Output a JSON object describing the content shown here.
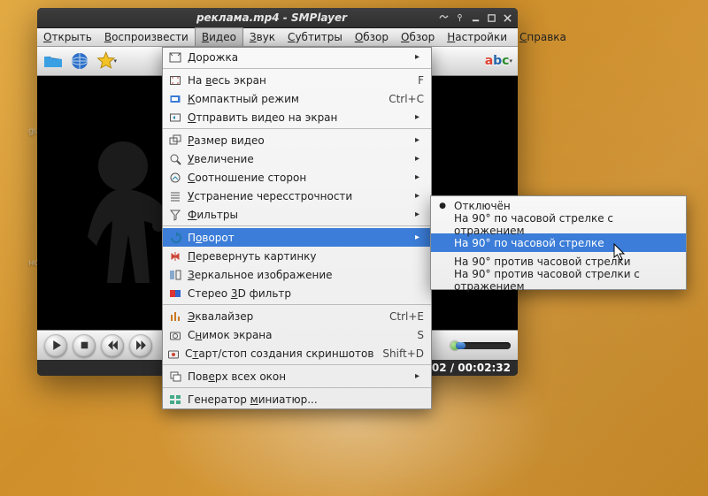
{
  "window": {
    "title": "реклама.mp4 - SMPlayer",
    "controls_icons": [
      "integrate-icon",
      "pin-icon",
      "minimize-icon",
      "maximize-icon",
      "close-icon"
    ]
  },
  "menubar": [
    {
      "label": "Открыть",
      "u": 0
    },
    {
      "label": "Воспроизвести",
      "u": 0
    },
    {
      "label": "Видео",
      "u": 0,
      "active": true
    },
    {
      "label": "Звук",
      "u": 0
    },
    {
      "label": "Субтитры",
      "u": 0
    },
    {
      "label": "Обзор",
      "u": 0
    },
    {
      "label": "Обзор",
      "u": 0
    },
    {
      "label": "Настройки",
      "u": 0
    },
    {
      "label": "Справка",
      "u": 0
    }
  ],
  "toolbar_icons": [
    "open-folder-icon",
    "globe-icon",
    "favorites-star-icon",
    "subtitles-abc-icon"
  ],
  "playback": {
    "buttons": [
      "play-icon",
      "stop-icon",
      "prev-icon",
      "next-icon"
    ],
    "position_pct": 1.4,
    "volume_pct": 18
  },
  "status": {
    "time": "00:00:02 / 00:02:32"
  },
  "video_menu": [
    {
      "icon": "track-icon",
      "label": "Дорожка",
      "u": 0,
      "sub": true
    },
    {
      "icon": "fullscreen-icon",
      "label": "На весь экран",
      "u": 3,
      "shortcut": "F"
    },
    {
      "icon": "compact-icon",
      "label": "Компактный режим",
      "u": 0,
      "shortcut": "Ctrl+C"
    },
    {
      "icon": "send-screen-icon",
      "label": "Отправить видео на экран",
      "u": 0,
      "sub": true
    },
    {
      "icon": "size-icon",
      "label": "Размер видео",
      "u": 0,
      "sub": true
    },
    {
      "icon": "zoom-icon",
      "label": "Увеличение",
      "u": 0,
      "sub": true
    },
    {
      "icon": "aspect-icon",
      "label": "Соотношение сторон",
      "u": 0,
      "sub": true
    },
    {
      "icon": "deinterlace-icon",
      "label": "Устранение чересстрочности",
      "u": 0,
      "sub": true
    },
    {
      "icon": "filters-icon",
      "label": "Фильтры",
      "u": 0,
      "sub": true
    },
    {
      "icon": "rotate-icon",
      "label": "Поворот",
      "u": 1,
      "sub": true,
      "highlight": true
    },
    {
      "icon": "flip-icon",
      "label": "Перевернуть картинку",
      "u": 0
    },
    {
      "icon": "mirror-icon",
      "label": "Зеркальное изображение",
      "u": 0
    },
    {
      "icon": "stereo3d-icon",
      "label": "Стерео 3D фильтр",
      "u": 7
    },
    {
      "icon": "equalizer-icon",
      "label": "Эквалайзер",
      "u": 0,
      "shortcut": "Ctrl+E"
    },
    {
      "icon": "screenshot-icon",
      "label": "Снимок экрана",
      "u": 1,
      "shortcut": "S"
    },
    {
      "icon": "scrcapture-icon",
      "label": "Старт/стоп создания скриншотов",
      "u": 1,
      "shortcut": "Shift+D"
    },
    {
      "icon": "ontop-icon",
      "label": "Поверх всех окон",
      "u": 3,
      "sub": true
    },
    {
      "icon": "thumbs-icon",
      "label": "Генератор миниатюр...",
      "u": 10
    }
  ],
  "separators_after": [
    0,
    3,
    8,
    12,
    15,
    16
  ],
  "rotate_submenu": [
    {
      "label": "Отключён",
      "u": 0,
      "checked": true
    },
    {
      "label": "На 90° по часовой стрелке с отражением",
      "u": 7
    },
    {
      "label": "На 90° по часовой стрелке",
      "u": 7,
      "highlight": true
    },
    {
      "label": "На 90° против часовой стрелки",
      "u": 7
    },
    {
      "label": "На 90° против часовой стрелки с отражением",
      "u": 7
    }
  ],
  "colors": {
    "highlight": "#3b7dd8"
  }
}
